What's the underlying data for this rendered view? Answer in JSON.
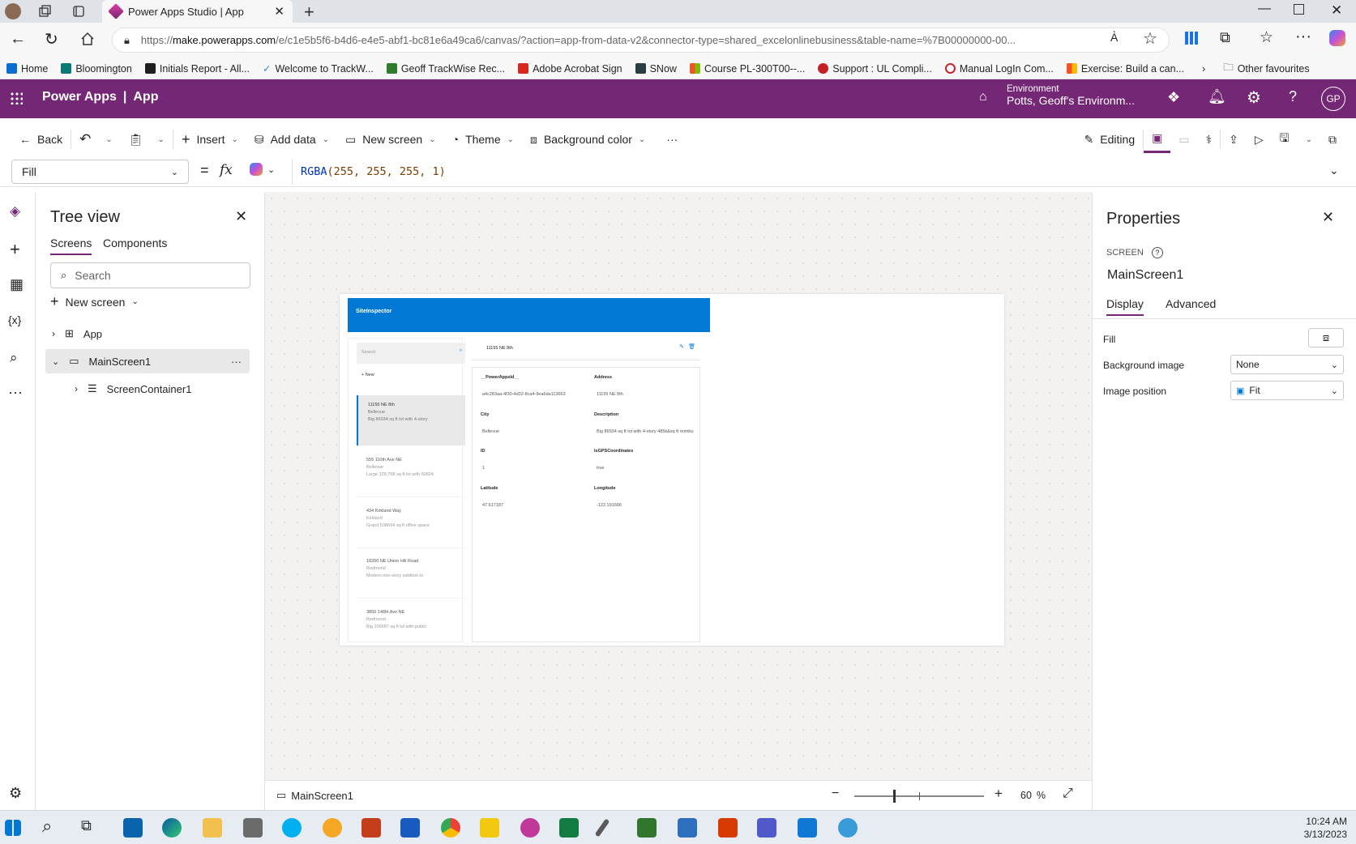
{
  "browser": {
    "tab_title": "Power Apps Studio | App",
    "url_prefix": "https://",
    "url_host": "make.powerapps.com",
    "url_rest": "/e/c1e5b5f6-b4d6-e4e5-abf1-bc81e6a49ca6/canvas/?action=app-from-data-v2&connector-type=shared_excelonlinebusiness&table-name=%7B00000000-00..."
  },
  "favorites": [
    {
      "label": "Home",
      "color": "#0a6ed1"
    },
    {
      "label": "Bloomington",
      "color": "#0b7a75"
    },
    {
      "label": "Initials Report - All...",
      "color": "#1f1f1f"
    },
    {
      "label": "Welcome to TrackW...",
      "color": "#3a8bd8"
    },
    {
      "label": "Geoff TrackWise Rec...",
      "color": "#2d7d2d"
    },
    {
      "label": "Adobe Acrobat Sign",
      "color": "#d7261e"
    },
    {
      "label": "SNow",
      "color": "#293e40"
    },
    {
      "label": "Course PL-300T00--...",
      "color": "#f35325"
    },
    {
      "label": "Support : UL Compli...",
      "color": "#c42026"
    },
    {
      "label": "Manual LogIn Com...",
      "color": "#c4262e"
    },
    {
      "label": "Exercise: Build a can...",
      "color": "#f35325"
    }
  ],
  "other_favorites": "Other favourites",
  "header": {
    "brand": "Power Apps",
    "separator": "|",
    "app": "App",
    "env_label": "Environment",
    "env_name": "Potts, Geoff's Environm...",
    "avatar": "GP",
    "color": "#742774"
  },
  "commands": {
    "back": "Back",
    "insert": "Insert",
    "add_data": "Add data",
    "new_screen": "New screen",
    "theme": "Theme",
    "background_color": "Background color",
    "more": "···",
    "editing": "Editing"
  },
  "formula": {
    "property": "Fill",
    "equals": "=",
    "fx": "fx",
    "fn": "RGBA",
    "args": "(255, 255, 255, 1)"
  },
  "tree": {
    "title": "Tree view",
    "tabs": [
      "Screens",
      "Components"
    ],
    "search_placeholder": "Search",
    "new_screen": "New screen",
    "items": [
      {
        "label": "App"
      },
      {
        "label": "MainScreen1"
      },
      {
        "label": "ScreenContainer1"
      }
    ]
  },
  "app_preview": {
    "title": "SiteInspector",
    "search": "Search",
    "new": "New",
    "list": [
      {
        "address": "11155 NE 8th",
        "city": "Bellevue",
        "desc": "Big 86934 sq ft lot with 4-story"
      },
      {
        "address": "555 110th Ave NE",
        "city": "Bellevue",
        "desc": "Large 128,768 sq ft lot with 50824"
      },
      {
        "address": "434 Kirkland Way",
        "city": "Kirkland",
        "desc": "Grand 538694 sq ft office space"
      },
      {
        "address": "18200 NE Union Hill Road",
        "city": "Redmond",
        "desc": "Modern one-story addition to"
      },
      {
        "address": "3850 148th Ave NE",
        "city": "Redmond",
        "desc": "Big 106687 sq ft lot with public"
      }
    ],
    "detail_title": "11155 NE 8th",
    "fields": [
      {
        "label": "__PowerAppsId__",
        "value": "a4c283aa-4f30-4d32-8ca4-9ea6da113663"
      },
      {
        "label": "Address",
        "value": "11155 NE 8th"
      },
      {
        "label": "City",
        "value": "Bellevue"
      },
      {
        "label": "Description",
        "value": "Big 86934 sq ft lot with 4-story 485k&sq ft reimbu"
      },
      {
        "label": "ID",
        "value": "1"
      },
      {
        "label": "IsGPSCoordinates",
        "value": "true"
      },
      {
        "label": "Latitude",
        "value": "47.617187"
      },
      {
        "label": "Longitude",
        "value": "-122.191686"
      }
    ]
  },
  "status": {
    "screen": "MainScreen1",
    "zoom": "60",
    "zoom_unit": "%",
    "minus": "−",
    "plus": "+"
  },
  "properties": {
    "title": "Properties",
    "kind": "SCREEN",
    "name": "MainScreen1",
    "tabs": [
      "Display",
      "Advanced"
    ],
    "fill_label": "Fill",
    "bg_image_label": "Background image",
    "bg_image_value": "None",
    "img_pos_label": "Image position",
    "img_pos_value": "Fit"
  },
  "taskbar": {
    "time": "10:24 AM",
    "date": "3/13/2023"
  }
}
